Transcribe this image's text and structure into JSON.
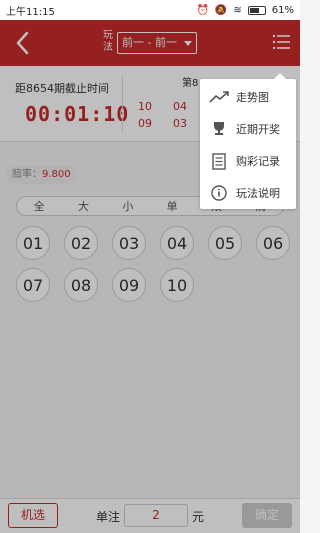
{
  "statusbar": {
    "time": "上午11:15",
    "battery": "61%"
  },
  "header": {
    "play_label": "玩法",
    "play_value": "前一 - 前一"
  },
  "info": {
    "deadline_label": "距8654期截止时间",
    "countdown": "00:01:10",
    "issue_label": "第8",
    "draw_numbers": [
      "10",
      "04",
      "09",
      "03"
    ]
  },
  "odds": {
    "label": "赔率：",
    "value": "9.800"
  },
  "filters": [
    "全",
    "大",
    "小",
    "单",
    "双",
    "清"
  ],
  "balls": [
    "01",
    "02",
    "03",
    "04",
    "05",
    "06",
    "07",
    "08",
    "09",
    "10"
  ],
  "bottom": {
    "machine_label": "机选",
    "single_label": "单注",
    "quantity": "2",
    "unit_label": "元",
    "confirm_label": "确定"
  },
  "menu": {
    "items": [
      {
        "label": "走势图",
        "icon": "trend-icon"
      },
      {
        "label": "近期开奖",
        "icon": "trophy-icon"
      },
      {
        "label": "购彩记录",
        "icon": "document-icon"
      },
      {
        "label": "玩法说明",
        "icon": "info-icon"
      }
    ]
  }
}
